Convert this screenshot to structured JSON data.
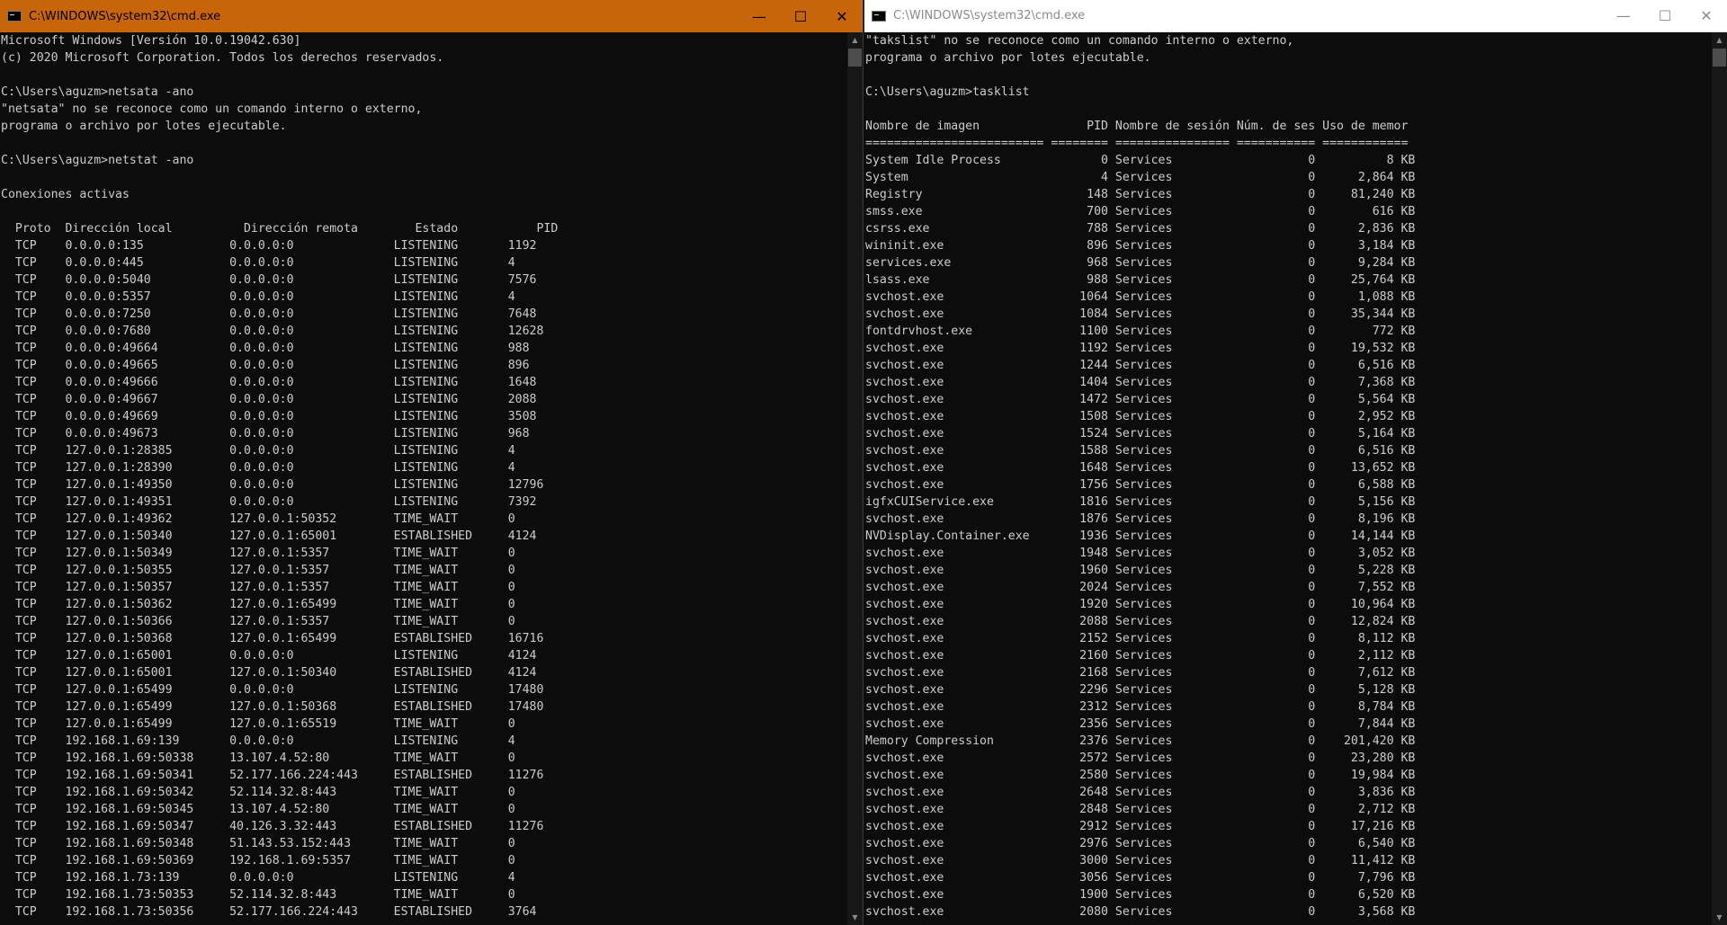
{
  "left": {
    "title": "C:\\WINDOWS\\system32\\cmd.exe",
    "lines": [
      "Microsoft Windows [Versión 10.0.19042.630]",
      "(c) 2020 Microsoft Corporation. Todos los derechos reservados.",
      "",
      "C:\\Users\\aguzm>netsata -ano",
      "\"netsata\" no se reconoce como un comando interno o externo,",
      "programa o archivo por lotes ejecutable.",
      "",
      "C:\\Users\\aguzm>netstat -ano",
      "",
      "Conexiones activas",
      "",
      "  Proto  Dirección local          Dirección remota        Estado           PID",
      "  TCP    0.0.0.0:135            0.0.0.0:0              LISTENING       1192",
      "  TCP    0.0.0.0:445            0.0.0.0:0              LISTENING       4",
      "  TCP    0.0.0.0:5040           0.0.0.0:0              LISTENING       7576",
      "  TCP    0.0.0.0:5357           0.0.0.0:0              LISTENING       4",
      "  TCP    0.0.0.0:7250           0.0.0.0:0              LISTENING       7648",
      "  TCP    0.0.0.0:7680           0.0.0.0:0              LISTENING       12628",
      "  TCP    0.0.0.0:49664          0.0.0.0:0              LISTENING       988",
      "  TCP    0.0.0.0:49665          0.0.0.0:0              LISTENING       896",
      "  TCP    0.0.0.0:49666          0.0.0.0:0              LISTENING       1648",
      "  TCP    0.0.0.0:49667          0.0.0.0:0              LISTENING       2088",
      "  TCP    0.0.0.0:49669          0.0.0.0:0              LISTENING       3508",
      "  TCP    0.0.0.0:49673          0.0.0.0:0              LISTENING       968",
      "  TCP    127.0.0.1:28385        0.0.0.0:0              LISTENING       4",
      "  TCP    127.0.0.1:28390        0.0.0.0:0              LISTENING       4",
      "  TCP    127.0.0.1:49350        0.0.0.0:0              LISTENING       12796",
      "  TCP    127.0.0.1:49351        0.0.0.0:0              LISTENING       7392",
      "  TCP    127.0.0.1:49362        127.0.0.1:50352        TIME_WAIT       0",
      "  TCP    127.0.0.1:50340        127.0.0.1:65001        ESTABLISHED     4124",
      "  TCP    127.0.0.1:50349        127.0.0.1:5357         TIME_WAIT       0",
      "  TCP    127.0.0.1:50355        127.0.0.1:5357         TIME_WAIT       0",
      "  TCP    127.0.0.1:50357        127.0.0.1:5357         TIME_WAIT       0",
      "  TCP    127.0.0.1:50362        127.0.0.1:65499        TIME_WAIT       0",
      "  TCP    127.0.0.1:50366        127.0.0.1:5357         TIME_WAIT       0",
      "  TCP    127.0.0.1:50368        127.0.0.1:65499        ESTABLISHED     16716",
      "  TCP    127.0.0.1:65001        0.0.0.0:0              LISTENING       4124",
      "  TCP    127.0.0.1:65001        127.0.0.1:50340        ESTABLISHED     4124",
      "  TCP    127.0.0.1:65499        0.0.0.0:0              LISTENING       17480",
      "  TCP    127.0.0.1:65499        127.0.0.1:50368        ESTABLISHED     17480",
      "  TCP    127.0.0.1:65499        127.0.0.1:65519        TIME_WAIT       0",
      "  TCP    192.168.1.69:139       0.0.0.0:0              LISTENING       4",
      "  TCP    192.168.1.69:50338     13.107.4.52:80         TIME_WAIT       0",
      "  TCP    192.168.1.69:50341     52.177.166.224:443     ESTABLISHED     11276",
      "  TCP    192.168.1.69:50342     52.114.32.8:443        TIME_WAIT       0",
      "  TCP    192.168.1.69:50345     13.107.4.52:80         TIME_WAIT       0",
      "  TCP    192.168.1.69:50347     40.126.3.32:443        ESTABLISHED     11276",
      "  TCP    192.168.1.69:50348     51.143.53.152:443      TIME_WAIT       0",
      "  TCP    192.168.1.69:50369     192.168.1.69:5357      TIME_WAIT       0",
      "  TCP    192.168.1.73:139       0.0.0.0:0              LISTENING       4",
      "  TCP    192.168.1.73:50353     52.114.32.8:443        TIME_WAIT       0",
      "  TCP    192.168.1.73:50356     52.177.166.224:443     ESTABLISHED     3764"
    ]
  },
  "right": {
    "title": "C:\\WINDOWS\\system32\\cmd.exe",
    "lines": [
      "\"takslist\" no se reconoce como un comando interno o externo,",
      "programa o archivo por lotes ejecutable.",
      "",
      "C:\\Users\\aguzm>tasklist",
      "",
      "Nombre de imagen               PID Nombre de sesión Núm. de ses Uso de memor",
      "========================= ======== ================ =========== ============",
      "System Idle Process              0 Services                   0          8 KB",
      "System                           4 Services                   0      2,864 KB",
      "Registry                       148 Services                   0     81,240 KB",
      "smss.exe                       700 Services                   0        616 KB",
      "csrss.exe                      788 Services                   0      2,836 KB",
      "wininit.exe                    896 Services                   0      3,184 KB",
      "services.exe                   968 Services                   0      9,284 KB",
      "lsass.exe                      988 Services                   0     25,764 KB",
      "svchost.exe                   1064 Services                   0      1,088 KB",
      "svchost.exe                   1084 Services                   0     35,344 KB",
      "fontdrvhost.exe               1100 Services                   0        772 KB",
      "svchost.exe                   1192 Services                   0     19,532 KB",
      "svchost.exe                   1244 Services                   0      6,516 KB",
      "svchost.exe                   1404 Services                   0      7,368 KB",
      "svchost.exe                   1472 Services                   0      5,564 KB",
      "svchost.exe                   1508 Services                   0      2,952 KB",
      "svchost.exe                   1524 Services                   0      5,164 KB",
      "svchost.exe                   1588 Services                   0      6,516 KB",
      "svchost.exe                   1648 Services                   0     13,652 KB",
      "svchost.exe                   1756 Services                   0      6,588 KB",
      "igfxCUIService.exe            1816 Services                   0      5,156 KB",
      "svchost.exe                   1876 Services                   0      8,196 KB",
      "NVDisplay.Container.exe       1936 Services                   0     14,144 KB",
      "svchost.exe                   1948 Services                   0      3,052 KB",
      "svchost.exe                   1960 Services                   0      5,228 KB",
      "svchost.exe                   2024 Services                   0      7,552 KB",
      "svchost.exe                   1920 Services                   0     10,964 KB",
      "svchost.exe                   2088 Services                   0     12,824 KB",
      "svchost.exe                   2152 Services                   0      8,112 KB",
      "svchost.exe                   2160 Services                   0      2,112 KB",
      "svchost.exe                   2168 Services                   0      7,612 KB",
      "svchost.exe                   2296 Services                   0      5,128 KB",
      "svchost.exe                   2312 Services                   0      8,784 KB",
      "svchost.exe                   2356 Services                   0      7,844 KB",
      "Memory Compression            2376 Services                   0    201,420 KB",
      "svchost.exe                   2572 Services                   0     23,280 KB",
      "svchost.exe                   2580 Services                   0     19,984 KB",
      "svchost.exe                   2648 Services                   0      3,836 KB",
      "svchost.exe                   2848 Services                   0      2,712 KB",
      "svchost.exe                   2912 Services                   0     17,216 KB",
      "svchost.exe                   2976 Services                   0      6,540 KB",
      "svchost.exe                   3000 Services                   0     11,412 KB",
      "svchost.exe                   3056 Services                   0      7,796 KB",
      "svchost.exe                   1900 Services                   0      6,520 KB",
      "svchost.exe                   2080 Services                   0      3,568 KB"
    ]
  },
  "controls": {
    "minimize": "—",
    "maximize": "☐",
    "close": "✕",
    "scroll_up": "▲",
    "scroll_down": "▼"
  },
  "colors": {
    "left_titlebar": "#c8640a",
    "right_titlebar": "#ffffff",
    "console_bg": "#0c0c0c",
    "console_text": "#cccccc"
  }
}
